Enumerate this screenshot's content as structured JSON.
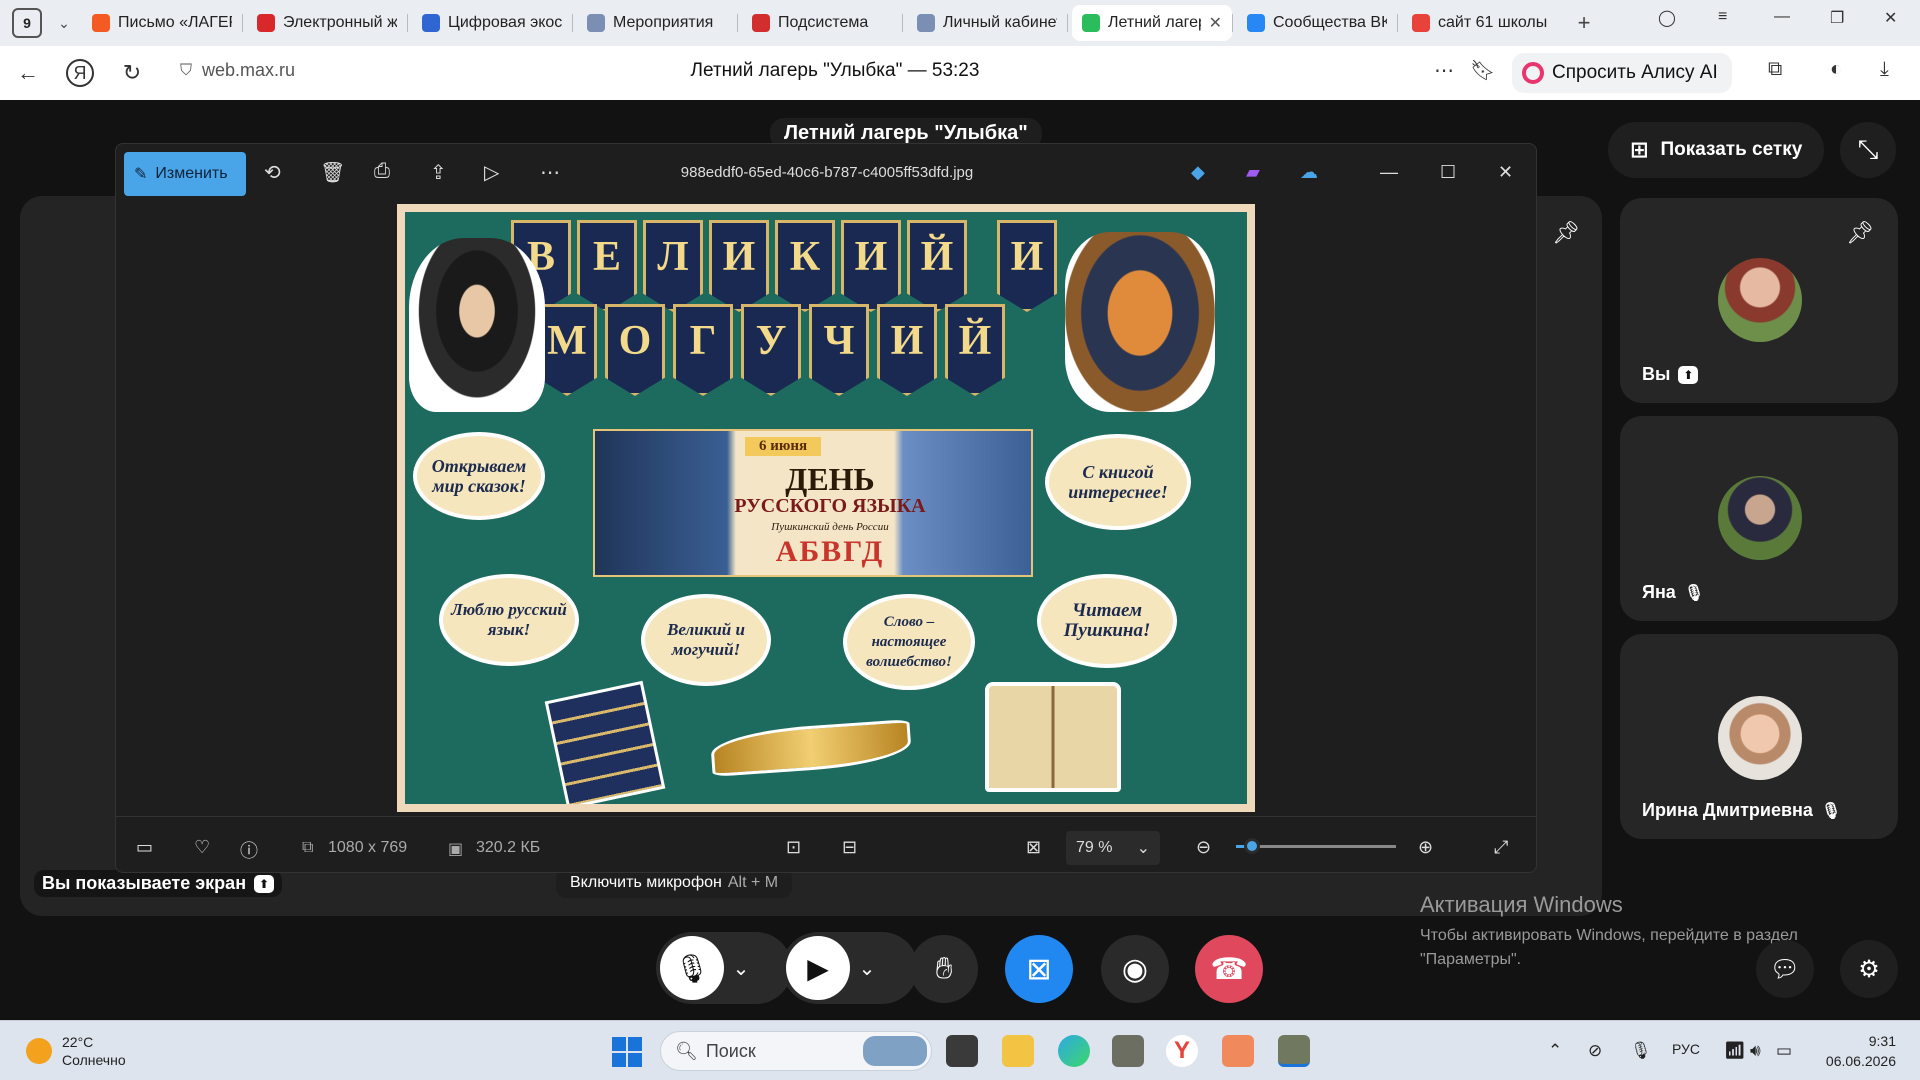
{
  "browser": {
    "tab_count": "9",
    "tabs": [
      {
        "title": "Письмо «ЛАГЕРЬ»",
        "color": "#f35b22"
      },
      {
        "title": "Электронный журнал",
        "color": "#d8282c"
      },
      {
        "title": "Цифровая экосистема",
        "color": "#2f66d2"
      },
      {
        "title": "Мероприятия",
        "color": "#7a8fb3"
      },
      {
        "title": "Подсистема",
        "color": "#d22e2e"
      },
      {
        "title": "Личный кабинет",
        "color": "#7a8fb3"
      },
      {
        "title": "Летний лагерь",
        "color": "#2bbd5b",
        "active": true
      },
      {
        "title": "Сообщества ВКонтакте",
        "color": "#2787f5"
      },
      {
        "title": "сайт 61 школы",
        "color": "#e8423a"
      }
    ],
    "url": "web.max.ru",
    "page_title": "Летний лагерь \"Улыбка\" — 53:23",
    "alisa_label": "Спросить Алису AI"
  },
  "call": {
    "title": "Летний лагерь \"Улыбка\"",
    "grid_button": "Показать сетку",
    "participants": [
      {
        "name": "Вы"
      },
      {
        "name": "Яна"
      },
      {
        "name": "Ирина Дмитриевна"
      }
    ],
    "share_status": "Вы показываете экран",
    "mic_tooltip": "Включить микрофон",
    "mic_shortcut": "Alt + M"
  },
  "viewer": {
    "edit_label": "Изменить",
    "file_name": "988eddf0-65ed-40c6-b787-c4005ff53dfd.jpg",
    "dimensions": "1080 x 769",
    "file_size": "320.2 КБ",
    "zoom": "79 %",
    "zoom_fraction": 0.1
  },
  "poster": {
    "row1": [
      "В",
      "Е",
      "Л",
      "И",
      "К",
      "И",
      "Й",
      "И"
    ],
    "row2": [
      "М",
      "О",
      "Г",
      "У",
      "Ч",
      "И",
      "Й"
    ],
    "banner_date": "6 июня",
    "banner_title1": "ДЕНЬ",
    "banner_title2": "РУССКОГО ЯЗЫКА",
    "banner_sub": "Пушкинский день России",
    "banner_letters": "АБВГД",
    "stickers": [
      "Открываем мир сказок!",
      "С книгой интереснее!",
      "Люблю русский язык!",
      "Великий и могучий!",
      "Слово – настоящее волшебство!",
      "Читаем Пушкина!"
    ]
  },
  "windows": {
    "activation_title": "Активация Windows",
    "activation_text": "Чтобы активировать Windows, перейдите в раздел \"Параметры\".",
    "temperature": "22°C",
    "weather": "Солнечно",
    "search_placeholder": "Поиск",
    "language": "РУС",
    "time": "9:31",
    "date": "06.06.2026"
  }
}
